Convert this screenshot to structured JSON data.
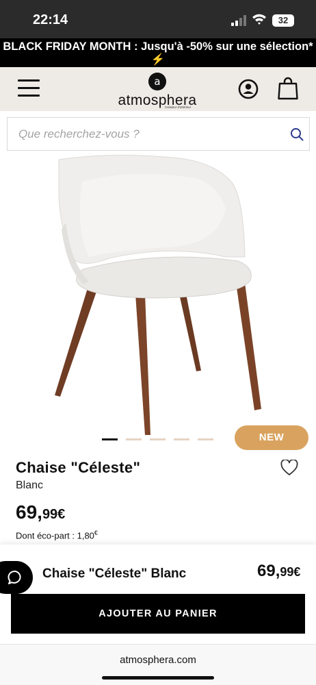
{
  "status_bar": {
    "time": "22:14",
    "battery": "32"
  },
  "promo": {
    "text": "BLACK FRIDAY MONTH : Jusqu'à -50% sur une sélection* ⚡"
  },
  "header": {
    "logo_text": "atmosphera",
    "logo_mark": "a",
    "logo_tagline": "Créateur d'intérieur",
    "icons": [
      "hamburger-menu-icon",
      "account-icon",
      "shopping-bag-icon"
    ]
  },
  "search": {
    "placeholder": "Que recherchez-vous ?",
    "value": ""
  },
  "carousel": {
    "slide_count": 5,
    "active_index": 0,
    "badge": "NEW"
  },
  "product": {
    "name": "Chaise \"Céleste\"",
    "variant": "Blanc",
    "price_int": "69,",
    "price_dec": "99€",
    "eco_part_label": "Dont éco-part : 1,80",
    "eco_part_currency": "€"
  },
  "sticky_bar": {
    "name": "Chaise \"Céleste\" Blanc",
    "price_int": "69,",
    "price_dec": "99€",
    "add_to_cart_label": "AJOUTER AU PANIER"
  },
  "browser": {
    "url": "atmosphera.com"
  },
  "colors": {
    "badge": "#d9a35f",
    "header_bg": "#eeeae5",
    "dot_inactive": "#e6d3c3"
  }
}
